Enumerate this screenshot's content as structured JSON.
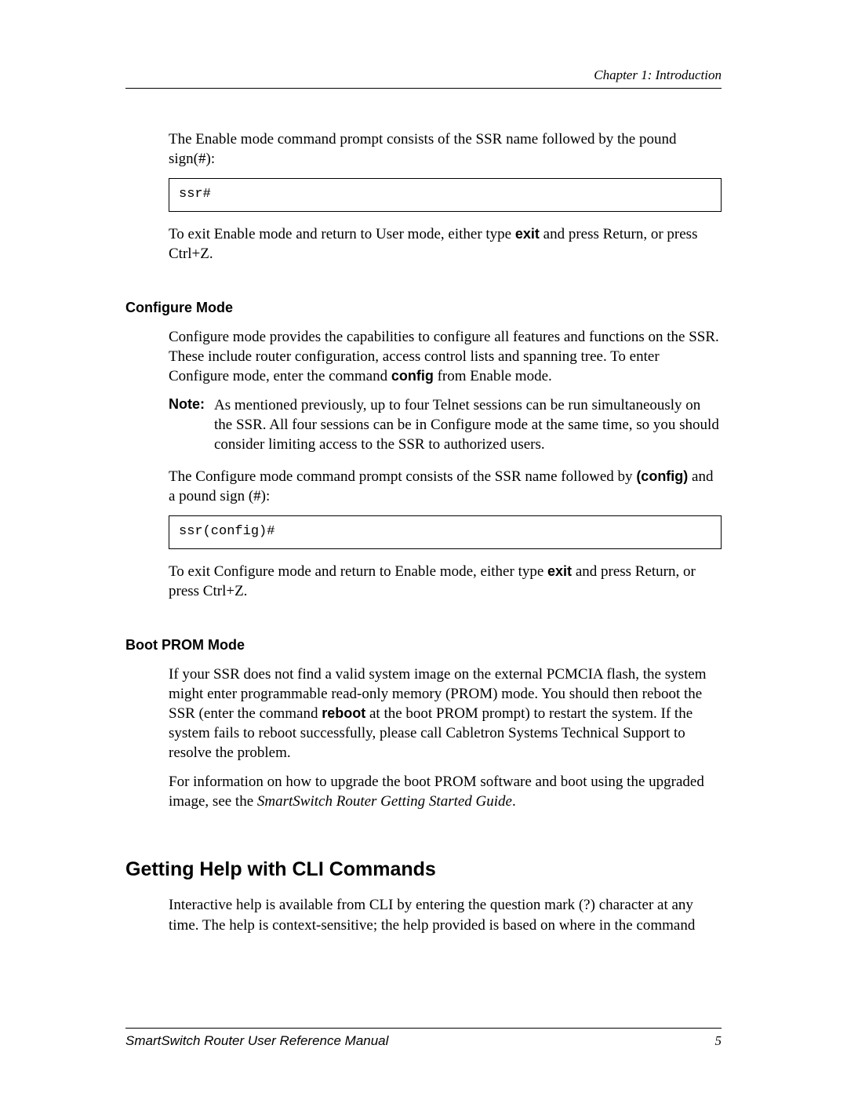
{
  "header": {
    "chapter": "Chapter 1: Introduction"
  },
  "enable": {
    "p1_a": "The Enable mode command prompt consists of the SSR name followed by the pound sign(#):",
    "code": "ssr#",
    "p2_a": "To exit Enable mode and return to User mode, either type ",
    "p2_bold": "exit",
    "p2_b": " and press Return, or press Ctrl+Z."
  },
  "configure": {
    "heading": "Configure Mode",
    "p1_a": "Configure mode provides the capabilities to configure all features and functions on the SSR. These include router configuration, access control lists and spanning tree. To enter Configure mode, enter the command ",
    "p1_bold": "config",
    "p1_b": " from Enable mode.",
    "note_label": "Note:",
    "note_body": "As mentioned previously, up to four Telnet sessions can be run simultaneously on the SSR. All four sessions can be in Configure mode at the same time, so you should consider limiting access to the SSR to authorized users.",
    "p2_a": "The Configure mode command prompt consists of the SSR name followed by ",
    "p2_bold": "(config)",
    "p2_b": " and a pound sign (#):",
    "code": "ssr(config)#",
    "p3_a": "To exit Configure mode and return to Enable mode, either type ",
    "p3_bold": "exit",
    "p3_b": " and press Return, or press Ctrl+Z."
  },
  "bootprom": {
    "heading": "Boot PROM Mode",
    "p1_a": "If your SSR does not find a valid system image on the external PCMCIA flash, the system might enter programmable read-only memory (PROM) mode. You should then reboot the SSR (enter the command ",
    "p1_bold": "reboot",
    "p1_b": " at the boot PROM prompt) to restart the system. If the system fails to reboot successfully, please call Cabletron Systems Technical Support to resolve the problem.",
    "p2_a": "For information on how to upgrade the boot PROM software and boot using the upgraded image, see the ",
    "p2_italic": "SmartSwitch Router Getting Started Guide",
    "p2_b": "."
  },
  "help": {
    "heading": "Getting Help with CLI Commands",
    "p1": "Interactive help is available from CLI by entering the question mark (?) character at any time. The help is context-sensitive; the help provided is based on where in the command"
  },
  "footer": {
    "manual": "SmartSwitch Router User Reference Manual",
    "page": "5"
  }
}
